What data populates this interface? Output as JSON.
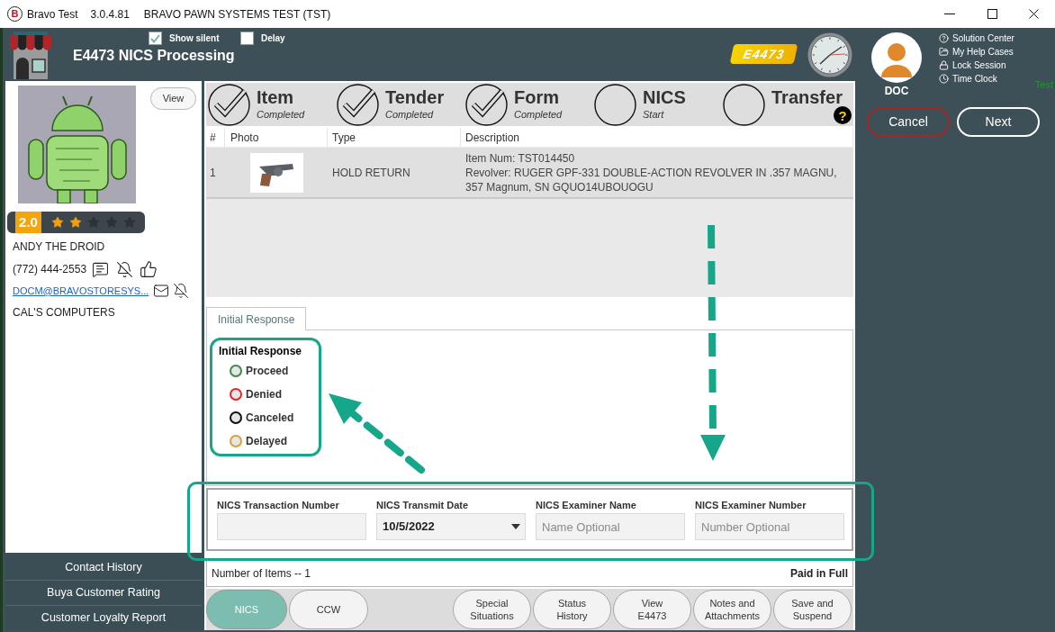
{
  "window": {
    "logo_letter": "B",
    "app_name": "Bravo Test",
    "version": "3.0.4.81",
    "title": "BRAVO PAWN SYSTEMS TEST (TST)"
  },
  "header": {
    "options": [
      {
        "label": "Show silent",
        "checked": true
      },
      {
        "label": "Delay",
        "checked": false
      }
    ],
    "title": "E4473 NICS Processing",
    "badge": "E4473",
    "user": "DOC",
    "help_links": [
      {
        "kind": "help",
        "label": "Solution Center"
      },
      {
        "kind": "folder",
        "label": "My Help Cases"
      },
      {
        "kind": "lock",
        "label": "Lock Session"
      },
      {
        "kind": "clock",
        "label": "Time Clock"
      }
    ],
    "environment": "Test",
    "actions": [
      {
        "kind": "cancel",
        "label": "Cancel"
      },
      {
        "kind": "next",
        "label": "Next"
      }
    ]
  },
  "customer": {
    "view_button": "View",
    "rating": "2.0",
    "stars": 2,
    "name": "ANDY THE DROID",
    "phone": "(772) 444-2553",
    "email": "DOCM@BRAVOSTORESYS...",
    "company": "CAL'S COMPUTERS"
  },
  "side_menu": [
    {
      "label": "Contact History"
    },
    {
      "label": "Buya Customer Rating"
    },
    {
      "label": "Customer Loyalty Report"
    }
  ],
  "steps": [
    {
      "title": "Item",
      "status": "Completed",
      "completed": true
    },
    {
      "title": "Tender",
      "status": "Completed",
      "completed": true
    },
    {
      "title": "Form",
      "status": "Completed",
      "completed": true
    },
    {
      "title": "NICS",
      "status": "Start",
      "completed": false
    },
    {
      "title": "Transfer",
      "completed": false
    }
  ],
  "steps_help": "?",
  "items_table": {
    "columns": [
      "#",
      "Photo",
      "Type",
      "Description"
    ],
    "rows": [
      {
        "number": "1",
        "type": "HOLD RETURN",
        "description": [
          "Item Num: TST014450",
          "Revolver: RUGER GPF-331 DOUBLE-ACTION REVOLVER IN .357 MAGNU, 357 Magnum, SN GQUO14UBOUOGU"
        ]
      }
    ]
  },
  "tabs": [
    {
      "label": "Initial Response",
      "selected": true
    }
  ],
  "initial_response": {
    "title": "Initial Response",
    "options": [
      {
        "label": "Proceed",
        "color": "#3d8b4a",
        "selected": false
      },
      {
        "label": "Denied",
        "color": "#e3262a",
        "selected": false
      },
      {
        "label": "Canceled",
        "color": "#111111",
        "selected": false
      },
      {
        "label": "Delayed",
        "color": "#d9a23a",
        "selected": false
      }
    ]
  },
  "nics_fields": [
    {
      "kind": "text",
      "label": "NICS Transaction Number"
    },
    {
      "kind": "dropdown",
      "label": "NICS Transmit Date",
      "value": "10/5/2022"
    },
    {
      "kind": "text",
      "label": "NICS Examiner Name",
      "placeholder": "Name Optional"
    },
    {
      "kind": "text",
      "label": "NICS Examiner Number",
      "placeholder": "Number Optional"
    }
  ],
  "summary": {
    "item_count": "Number of Items -- 1",
    "payment_status": "Paid in Full"
  },
  "mode_tabs": [
    {
      "label": "NICS",
      "selected": true
    },
    {
      "label": "CCW",
      "selected": false
    }
  ],
  "actions": [
    "Special\nSituations",
    "Status\nHistory",
    "View\nE4473",
    "Notes and\nAttachments",
    "Save and\nSuspend"
  ]
}
